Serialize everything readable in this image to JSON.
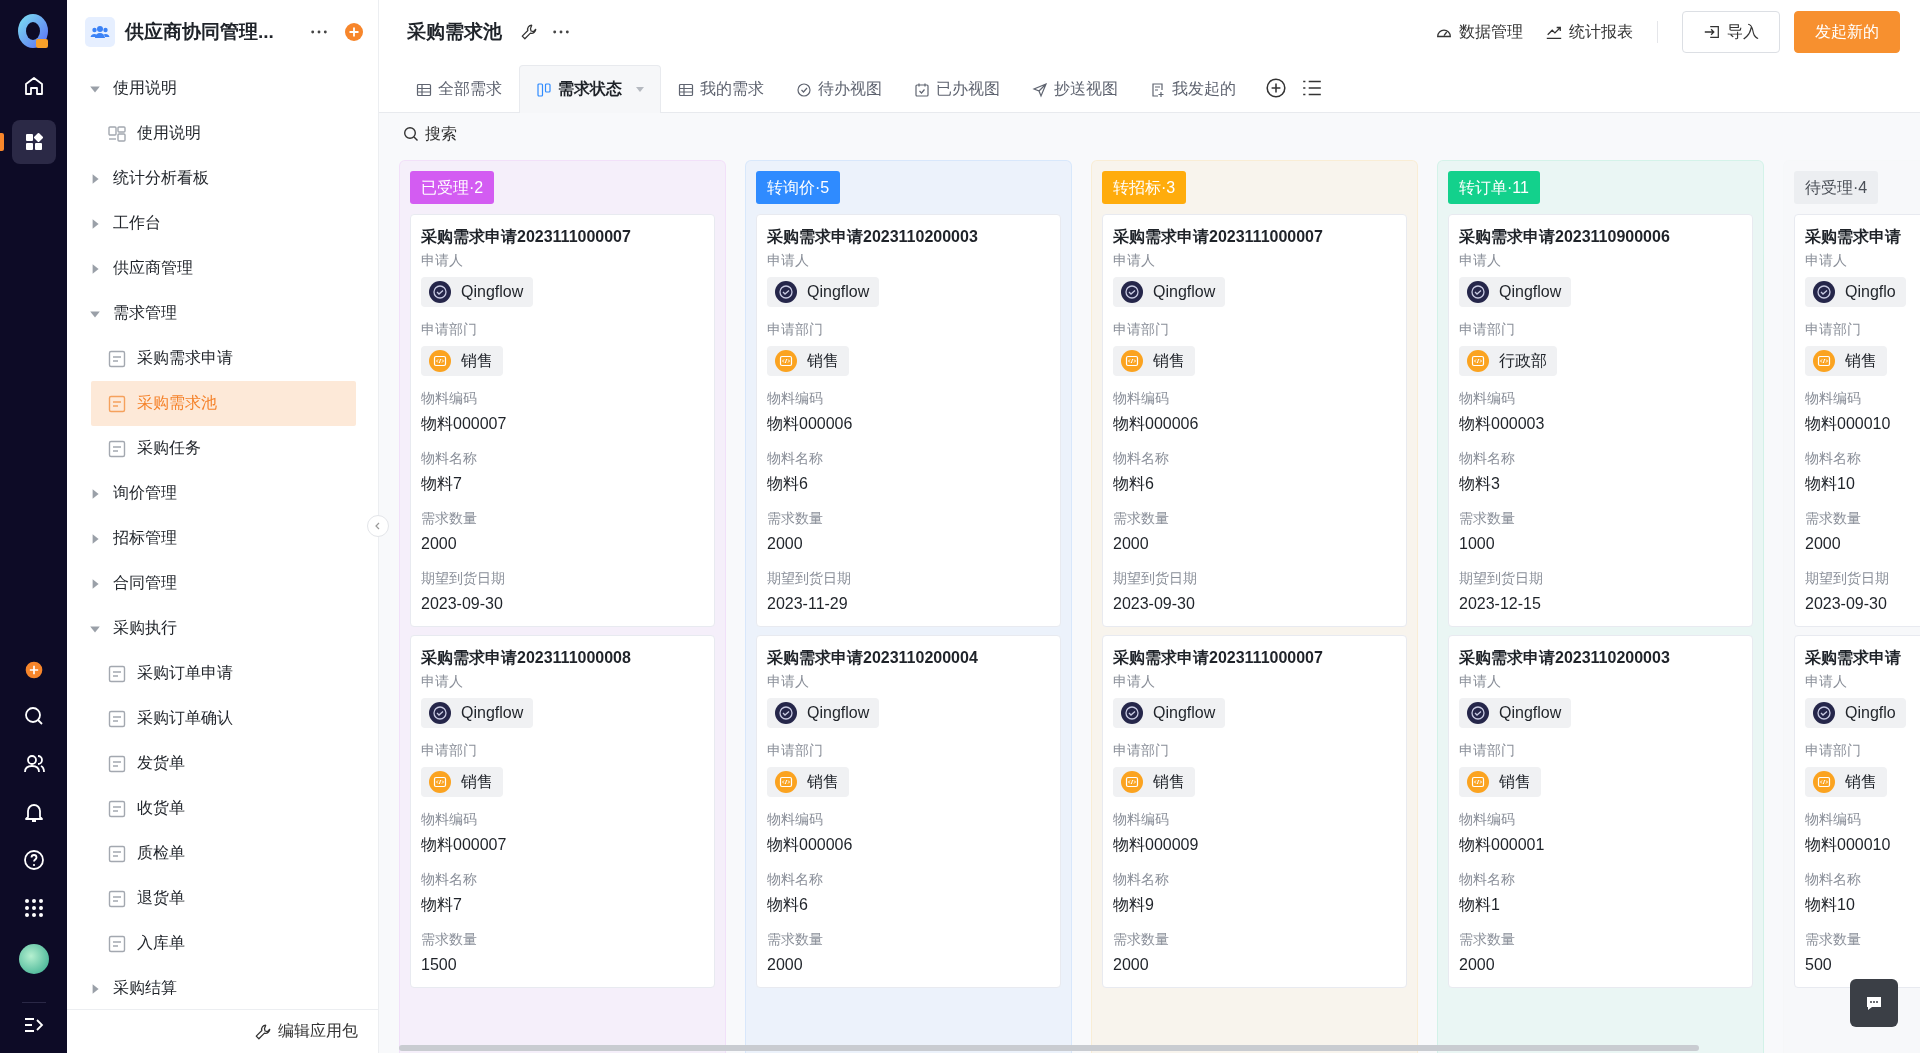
{
  "rail": {
    "top": [
      {
        "kind": "home",
        "selected": false
      },
      {
        "kind": "apps",
        "selected": true
      }
    ],
    "bottom": [
      {
        "kind": "add"
      },
      {
        "kind": "search"
      },
      {
        "kind": "contacts"
      },
      {
        "kind": "bell"
      },
      {
        "kind": "help"
      },
      {
        "kind": "grid"
      },
      {
        "kind": "avatar"
      },
      {
        "kind": "collapse"
      }
    ]
  },
  "sidebar": {
    "app_title": "供应商协同管理...",
    "tree": [
      {
        "label": "使用说明",
        "expanded": true,
        "children": [
          {
            "label": "使用说明",
            "kind": "dashboard",
            "selected": false
          }
        ]
      },
      {
        "label": "统计分析看板",
        "expanded": false
      },
      {
        "label": "工作台",
        "expanded": false
      },
      {
        "label": "供应商管理",
        "expanded": false
      },
      {
        "label": "需求管理",
        "expanded": true,
        "children": [
          {
            "label": "采购需求申请",
            "kind": "form",
            "selected": false
          },
          {
            "label": "采购需求池",
            "kind": "form",
            "selected": true
          },
          {
            "label": "采购任务",
            "kind": "form",
            "selected": false
          }
        ]
      },
      {
        "label": "询价管理",
        "expanded": false
      },
      {
        "label": "招标管理",
        "expanded": false
      },
      {
        "label": "合同管理",
        "expanded": false
      },
      {
        "label": "采购执行",
        "expanded": true,
        "children": [
          {
            "label": "采购订单申请",
            "kind": "form",
            "selected": false
          },
          {
            "label": "采购订单确认",
            "kind": "form",
            "selected": false
          },
          {
            "label": "发货单",
            "kind": "form",
            "selected": false
          },
          {
            "label": "收货单",
            "kind": "form",
            "selected": false
          },
          {
            "label": "质检单",
            "kind": "form",
            "selected": false
          },
          {
            "label": "退货单",
            "kind": "form",
            "selected": false
          },
          {
            "label": "入库单",
            "kind": "form",
            "selected": false
          }
        ]
      },
      {
        "label": "采购结算",
        "expanded": false
      }
    ],
    "footer": "编辑应用包"
  },
  "header": {
    "title": "采购需求池",
    "links": [
      {
        "label": "数据管理",
        "kind": "gauge"
      },
      {
        "label": "统计报表",
        "kind": "trend"
      }
    ],
    "buttons": [
      {
        "label": "导入",
        "kind": "outline"
      },
      {
        "label": "发起新的",
        "kind": "primary"
      }
    ]
  },
  "tabs": [
    {
      "label": "全部需求",
      "kind": "table",
      "selected": false
    },
    {
      "label": "需求状态",
      "kind": "board",
      "selected": true
    },
    {
      "label": "我的需求",
      "kind": "table",
      "selected": false
    },
    {
      "label": "待办视图",
      "kind": "check",
      "selected": false
    },
    {
      "label": "已办视图",
      "kind": "calendar",
      "selected": false
    },
    {
      "label": "抄送视图",
      "kind": "send",
      "selected": false
    },
    {
      "label": "我发起的",
      "kind": "doc",
      "selected": false
    }
  ],
  "search": {
    "placeholder": "搜索"
  },
  "columns": [
    {
      "label": "已受理·2",
      "color": "#d35cf2",
      "cards": [
        {
          "title": "采购需求申请2023111000007",
          "fields": [
            {
              "label": "申请人",
              "value": "Qingflow",
              "kind": "person"
            },
            {
              "label": "申请部门",
              "value": "销售",
              "kind": "dept"
            },
            {
              "label": "物料编码",
              "value": "物料000007",
              "kind": "text"
            },
            {
              "label": "物料名称",
              "value": "物料7",
              "kind": "text"
            },
            {
              "label": "需求数量",
              "value": "2000",
              "kind": "text"
            },
            {
              "label": "期望到货日期",
              "value": "2023-09-30",
              "kind": "text"
            }
          ]
        },
        {
          "title": "采购需求申请2023111000008",
          "fields": [
            {
              "label": "申请人",
              "value": "Qingflow",
              "kind": "person"
            },
            {
              "label": "申请部门",
              "value": "销售",
              "kind": "dept"
            },
            {
              "label": "物料编码",
              "value": "物料000007",
              "kind": "text"
            },
            {
              "label": "物料名称",
              "value": "物料7",
              "kind": "text"
            },
            {
              "label": "需求数量",
              "value": "1500",
              "kind": "text"
            }
          ]
        }
      ]
    },
    {
      "label": "转询价·5",
      "color": "#2f8bff",
      "cards": [
        {
          "title": "采购需求申请2023110200003",
          "fields": [
            {
              "label": "申请人",
              "value": "Qingflow",
              "kind": "person"
            },
            {
              "label": "申请部门",
              "value": "销售",
              "kind": "dept"
            },
            {
              "label": "物料编码",
              "value": "物料000006",
              "kind": "text"
            },
            {
              "label": "物料名称",
              "value": "物料6",
              "kind": "text"
            },
            {
              "label": "需求数量",
              "value": "2000",
              "kind": "text"
            },
            {
              "label": "期望到货日期",
              "value": "2023-11-29",
              "kind": "text"
            }
          ]
        },
        {
          "title": "采购需求申请2023110200004",
          "fields": [
            {
              "label": "申请人",
              "value": "Qingflow",
              "kind": "person"
            },
            {
              "label": "申请部门",
              "value": "销售",
              "kind": "dept"
            },
            {
              "label": "物料编码",
              "value": "物料000006",
              "kind": "text"
            },
            {
              "label": "物料名称",
              "value": "物料6",
              "kind": "text"
            },
            {
              "label": "需求数量",
              "value": "2000",
              "kind": "text"
            }
          ]
        }
      ]
    },
    {
      "label": "转招标·3",
      "color": "#ffac0c",
      "cards": [
        {
          "title": "采购需求申请2023111000007",
          "fields": [
            {
              "label": "申请人",
              "value": "Qingflow",
              "kind": "person"
            },
            {
              "label": "申请部门",
              "value": "销售",
              "kind": "dept"
            },
            {
              "label": "物料编码",
              "value": "物料000006",
              "kind": "text"
            },
            {
              "label": "物料名称",
              "value": "物料6",
              "kind": "text"
            },
            {
              "label": "需求数量",
              "value": "2000",
              "kind": "text"
            },
            {
              "label": "期望到货日期",
              "value": "2023-09-30",
              "kind": "text"
            }
          ]
        },
        {
          "title": "采购需求申请2023111000007",
          "fields": [
            {
              "label": "申请人",
              "value": "Qingflow",
              "kind": "person"
            },
            {
              "label": "申请部门",
              "value": "销售",
              "kind": "dept"
            },
            {
              "label": "物料编码",
              "value": "物料000009",
              "kind": "text"
            },
            {
              "label": "物料名称",
              "value": "物料9",
              "kind": "text"
            },
            {
              "label": "需求数量",
              "value": "2000",
              "kind": "text"
            }
          ]
        }
      ]
    },
    {
      "label": "转订单·11",
      "color": "#13d18c",
      "cards": [
        {
          "title": "采购需求申请2023110900006",
          "fields": [
            {
              "label": "申请人",
              "value": "Qingflow",
              "kind": "person"
            },
            {
              "label": "申请部门",
              "value": "行政部",
              "kind": "dept"
            },
            {
              "label": "物料编码",
              "value": "物料000003",
              "kind": "text"
            },
            {
              "label": "物料名称",
              "value": "物料3",
              "kind": "text"
            },
            {
              "label": "需求数量",
              "value": "1000",
              "kind": "text"
            },
            {
              "label": "期望到货日期",
              "value": "2023-12-15",
              "kind": "text"
            }
          ]
        },
        {
          "title": "采购需求申请2023110200003",
          "fields": [
            {
              "label": "申请人",
              "value": "Qingflow",
              "kind": "person"
            },
            {
              "label": "申请部门",
              "value": "销售",
              "kind": "dept"
            },
            {
              "label": "物料编码",
              "value": "物料000001",
              "kind": "text"
            },
            {
              "label": "物料名称",
              "value": "物料1",
              "kind": "text"
            },
            {
              "label": "需求数量",
              "value": "2000",
              "kind": "text"
            }
          ]
        }
      ]
    },
    {
      "label": "待受理·4",
      "color": "#eceef1",
      "cards": [
        {
          "title": "采购需求申请",
          "fields": [
            {
              "label": "申请人",
              "value": "Qingflo",
              "kind": "person"
            },
            {
              "label": "申请部门",
              "value": "销售",
              "kind": "dept"
            },
            {
              "label": "物料编码",
              "value": "物料000010",
              "kind": "text"
            },
            {
              "label": "物料名称",
              "value": "物料10",
              "kind": "text"
            },
            {
              "label": "需求数量",
              "value": "2000",
              "kind": "text"
            },
            {
              "label": "期望到货日期",
              "value": "2023-09-30",
              "kind": "text"
            }
          ]
        },
        {
          "title": "采购需求申请",
          "fields": [
            {
              "label": "申请人",
              "value": "Qingflo",
              "kind": "person"
            },
            {
              "label": "申请部门",
              "value": "销售",
              "kind": "dept"
            },
            {
              "label": "物料编码",
              "value": "物料000010",
              "kind": "text"
            },
            {
              "label": "物料名称",
              "value": "物料10",
              "kind": "text"
            },
            {
              "label": "需求数量",
              "value": "500",
              "kind": "text"
            }
          ]
        }
      ]
    }
  ]
}
